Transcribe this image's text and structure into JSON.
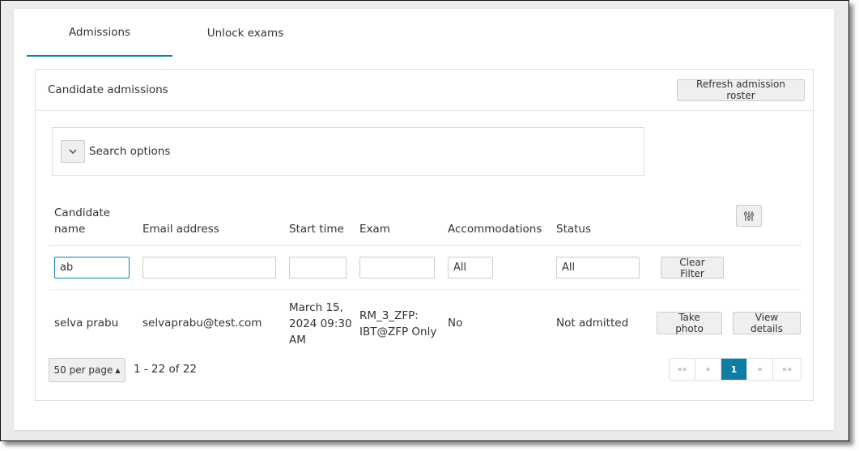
{
  "tabs": [
    {
      "label": "Admissions",
      "active": true
    },
    {
      "label": "Unlock exams",
      "active": false
    }
  ],
  "panel": {
    "title": "Candidate admissions",
    "refresh_label": "Refresh admission roster"
  },
  "search": {
    "label": "Search options",
    "icon": "chevron-down-icon"
  },
  "table": {
    "columns": [
      {
        "line1": "Candidate",
        "line2": "name"
      },
      {
        "label": "Email address"
      },
      {
        "label": "Start time"
      },
      {
        "label": "Exam"
      },
      {
        "label": "Accommodations"
      },
      {
        "label": "Status"
      }
    ],
    "settings_icon": "column-settings-icon",
    "filters": {
      "candidate_name": "ab",
      "email": "",
      "start_time": "",
      "exam": "",
      "accommodations": "All",
      "status": "All",
      "clear_label": "Clear Filter"
    },
    "rows": [
      {
        "name": "selva prabu",
        "email": "selvaprabu@test.com",
        "start_line1": "March 15,",
        "start_line2": "2024 09:30",
        "start_line3": "AM",
        "exam_line1": "RM_3_ZFP:",
        "exam_line2": "IBT@ZFP Only",
        "accommodations": "No",
        "status": "Not admitted",
        "take_photo_label": "Take photo",
        "view_details_label": "View details"
      }
    ]
  },
  "pagination": {
    "per_page_label": "50 per page",
    "range": "1 - 22 of 22",
    "first": "«‹",
    "prev": "«",
    "current": "1",
    "next": "»",
    "last": "»»"
  },
  "colors": {
    "accent": "#0c83a8"
  }
}
